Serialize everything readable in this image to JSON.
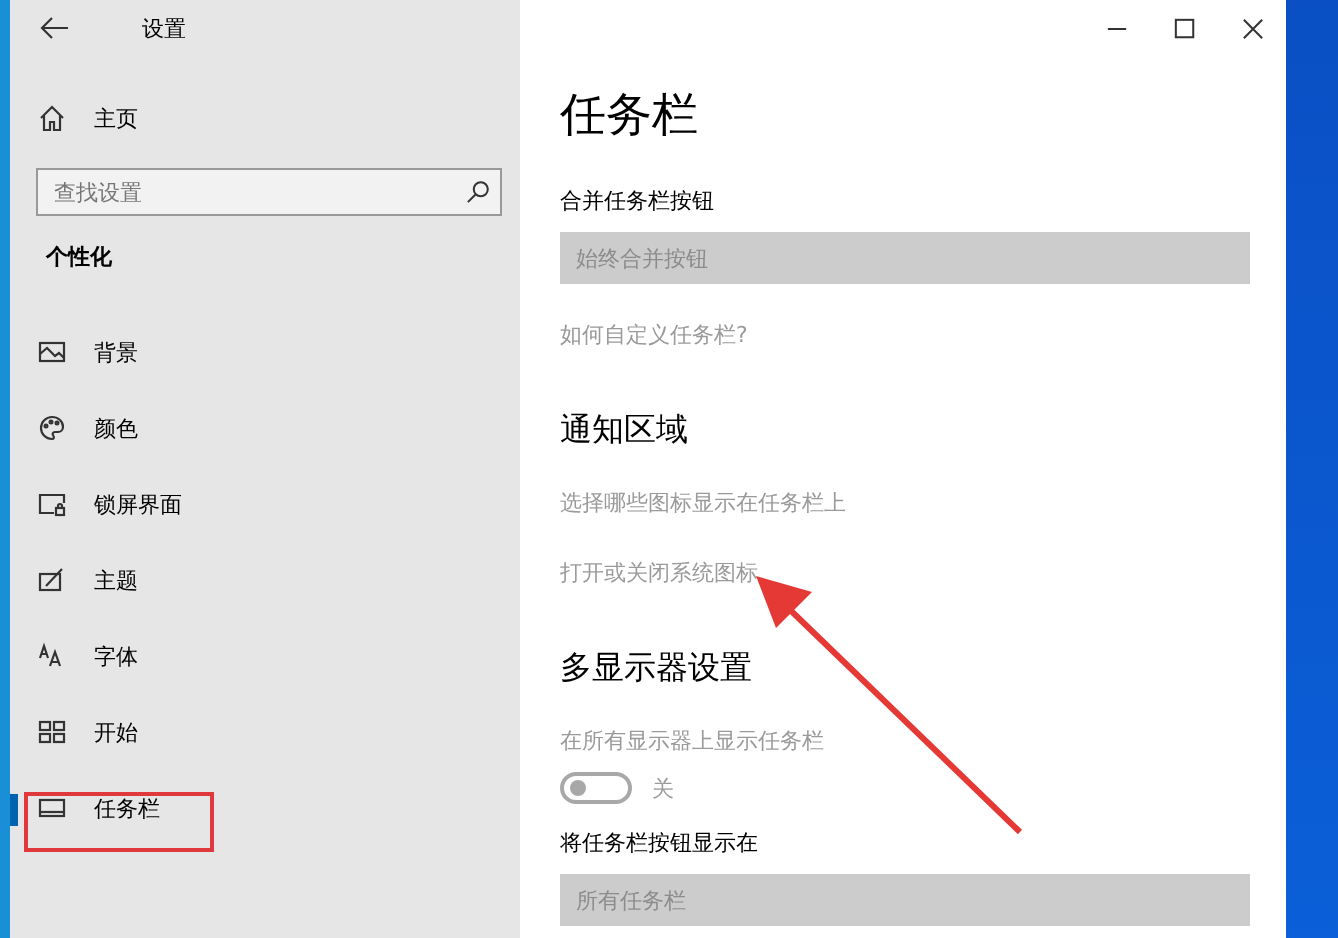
{
  "window": {
    "title": "设置"
  },
  "sidebar": {
    "home": {
      "label": "主页"
    },
    "search": {
      "placeholder": "查找设置"
    },
    "section": "个性化",
    "items": [
      {
        "label": "背景",
        "selected": false
      },
      {
        "label": "颜色",
        "selected": false
      },
      {
        "label": "锁屏界面",
        "selected": false
      },
      {
        "label": "主题",
        "selected": false
      },
      {
        "label": "字体",
        "selected": false
      },
      {
        "label": "开始",
        "selected": false
      },
      {
        "label": "任务栏",
        "selected": true
      }
    ]
  },
  "page": {
    "title": "任务栏",
    "items": [
      {
        "kind": "label",
        "text": "合并任务栏按钮",
        "disabled": false
      },
      {
        "kind": "dropdown",
        "value": "始终合并按钮",
        "disabled": true
      },
      {
        "kind": "link",
        "text": "如何自定义任务栏?",
        "disabled": true
      },
      {
        "kind": "heading",
        "text": "通知区域"
      },
      {
        "kind": "link",
        "text": "选择哪些图标显示在任务栏上",
        "disabled": true
      },
      {
        "kind": "link",
        "text": "打开或关闭系统图标",
        "disabled": true
      },
      {
        "kind": "heading",
        "text": "多显示器设置"
      },
      {
        "kind": "label",
        "text": "在所有显示器上显示任务栏",
        "disabled": true
      },
      {
        "kind": "toggle",
        "on": false,
        "label": "关",
        "disabled": true
      },
      {
        "kind": "label",
        "text": "将任务栏按钮显示在",
        "disabled": false
      },
      {
        "kind": "dropdown",
        "value": "所有任务栏",
        "disabled": true
      }
    ]
  }
}
